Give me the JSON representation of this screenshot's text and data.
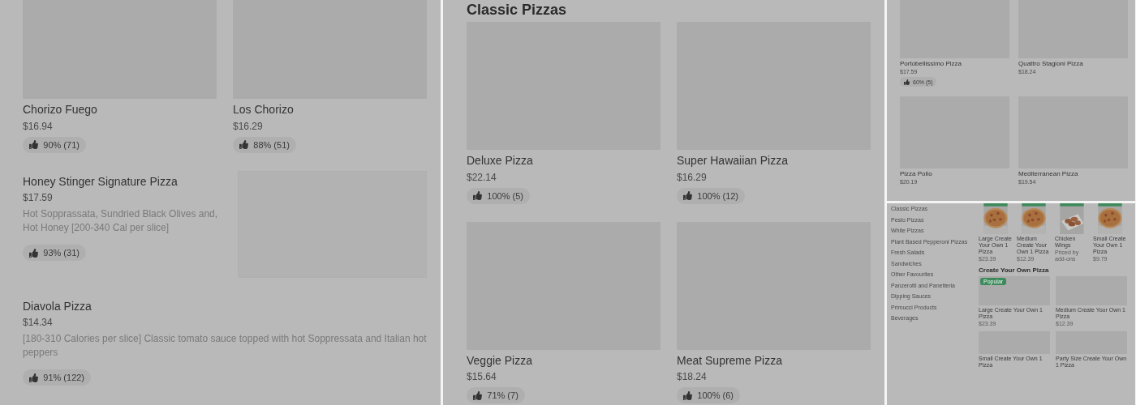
{
  "panel_1": {
    "items": [
      {
        "kind": "tile",
        "title": "Chorizo Fuego",
        "price": "$16.94",
        "rating": "90% (71)"
      },
      {
        "kind": "tile",
        "title": "Los Chorizo",
        "price": "$16.29",
        "rating": "88% (51)"
      },
      {
        "kind": "row_with_image",
        "title": "Honey Stinger Signature Pizza",
        "price": "$17.59",
        "description": "Hot Sopprassata, Sundried Black Olives and, Hot Honey [200-340 Cal per slice]",
        "rating": "93% (31)"
      },
      {
        "kind": "row",
        "title": "Diavola Pizza",
        "price": "$14.34",
        "description": "[180-310 Calories per slice] Classic tomato sauce topped with hot Soppressata and Italian hot peppers",
        "rating": "91% (122)"
      }
    ]
  },
  "panel_2": {
    "heading": "Classic Pizzas",
    "items": [
      {
        "kind": "tile",
        "title": "Deluxe Pizza",
        "price": "$22.14",
        "rating": "100% (5)"
      },
      {
        "kind": "tile",
        "title": "Super Hawaiian Pizza",
        "price": "$16.29",
        "rating": "100% (12)"
      },
      {
        "kind": "tile",
        "title": "Veggie Pizza",
        "price": "$15.64",
        "rating": "71% (7)"
      },
      {
        "kind": "tile",
        "title": "Meat Supreme Pizza",
        "price": "$18.24",
        "rating": "100% (6)"
      }
    ]
  },
  "panel_3": {
    "items": [
      {
        "kind": "tile",
        "title": "Portobellissimo Pizza",
        "price": "$17.59",
        "rating": "60% (5)"
      },
      {
        "kind": "tile",
        "title": "Quattro Stagioni Pizza",
        "price": "$18.24"
      },
      {
        "kind": "tile",
        "title": "Pizza Pollo",
        "price": "$20.19"
      },
      {
        "kind": "tile",
        "title": "Mediterranean Pizza",
        "price": "$19.54"
      }
    ]
  },
  "panel_4": {
    "sidebar": [
      "Classic Pizzas",
      "Pesto Pizzas",
      "White Pizzas",
      "Plant Based Pepperoni Pizzas",
      "Fresh Salads",
      "Sandwiches",
      "Other Favourites",
      "Panzerotti and Panetteria",
      "Dipping Sauces",
      "Primucci Products",
      "Beverages"
    ],
    "carousel": [
      {
        "kind": "pizza",
        "title": "Large Create Your Own 1 Pizza",
        "price": "$23.39"
      },
      {
        "kind": "pizza",
        "title": "Medium Create Your Own 1 Pizza",
        "price": "$12.39"
      },
      {
        "kind": "wings",
        "title": "Chicken Wings",
        "price": "Priced by add-ons"
      },
      {
        "kind": "pizza",
        "title": "Small Create Your Own 1 Pizza",
        "price": "$9.79"
      }
    ],
    "section": {
      "heading": "Create Your Own Pizza",
      "items": [
        {
          "title": "Large Create Your Own 1 Pizza",
          "price": "$23.39",
          "badge": "Popular"
        },
        {
          "title": "Medium Create Your Own 1 Pizza",
          "price": "$12.39"
        },
        {
          "title": "Small Create Your Own 1 Pizza"
        },
        {
          "title": "Party Size Create Your Own 1 Pizza"
        }
      ]
    }
  }
}
